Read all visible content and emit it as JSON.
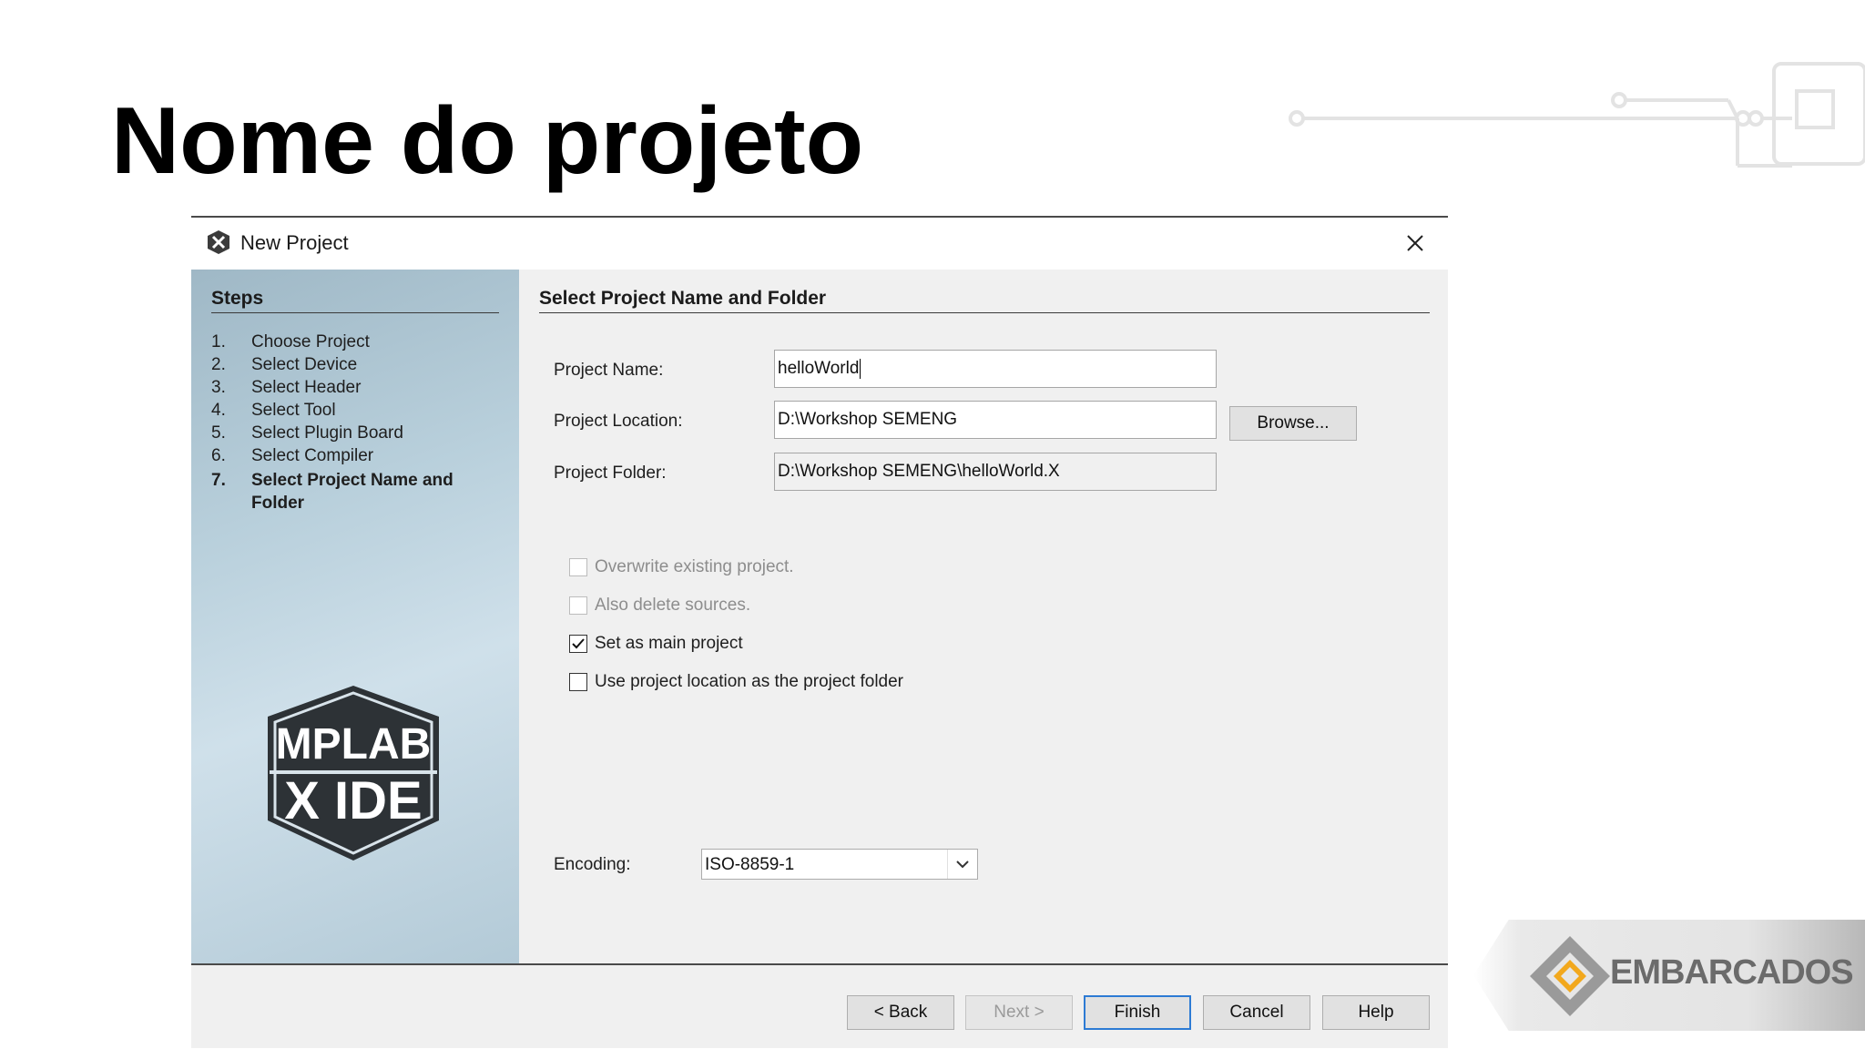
{
  "slide": {
    "title": "Nome do projeto",
    "brand": "EMBARCADOS"
  },
  "dialog": {
    "title": "New Project",
    "steps_heading": "Steps",
    "steps": [
      {
        "num": "1.",
        "label": "Choose Project"
      },
      {
        "num": "2.",
        "label": "Select Device"
      },
      {
        "num": "3.",
        "label": "Select Header"
      },
      {
        "num": "4.",
        "label": "Select Tool"
      },
      {
        "num": "5.",
        "label": "Select Plugin Board"
      },
      {
        "num": "6.",
        "label": "Select Compiler"
      },
      {
        "num": "7.",
        "label": "Select Project Name and Folder"
      }
    ],
    "current_step": 7,
    "side_logo": {
      "line1": "MPLAB",
      "line2": "X IDE"
    },
    "section_title": "Select Project Name and Folder",
    "fields": {
      "project_name": {
        "label": "Project Name:",
        "value": "helloWorld"
      },
      "project_location": {
        "label": "Project Location:",
        "value": "D:\\Workshop SEMENG"
      },
      "project_folder": {
        "label": "Project Folder:",
        "value": "D:\\Workshop SEMENG\\helloWorld.X"
      }
    },
    "browse_label": "Browse...",
    "checkboxes": [
      {
        "label": "Overwrite existing project.",
        "checked": false,
        "enabled": false
      },
      {
        "label": "Also delete sources.",
        "checked": false,
        "enabled": false
      },
      {
        "label": "Set as main project",
        "checked": true,
        "enabled": true
      },
      {
        "label": "Use project location as the project folder",
        "checked": false,
        "enabled": true
      }
    ],
    "encoding": {
      "label": "Encoding:",
      "value": "ISO-8859-1"
    },
    "buttons": {
      "back": "< Back",
      "next": "Next >",
      "finish": "Finish",
      "cancel": "Cancel",
      "help": "Help"
    },
    "colors": {
      "default_button_border": "#2d7bd4",
      "side_panel": "#b9d0dc"
    }
  }
}
